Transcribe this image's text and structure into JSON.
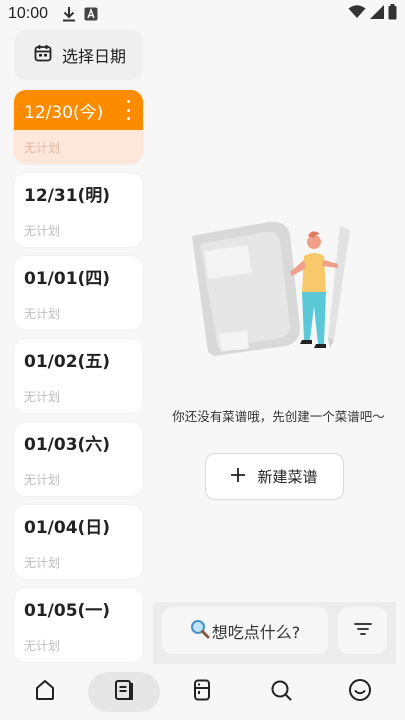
{
  "status_bar": {
    "time": "10:00",
    "icons": [
      "download-icon",
      "a-notification-icon",
      "wifi-icon",
      "signal-icon",
      "battery-icon"
    ]
  },
  "date_select": {
    "label": "选择日期",
    "icon": "calendar-icon"
  },
  "dates": [
    {
      "date": "12/30(今)",
      "plan": "无计划",
      "active": true
    },
    {
      "date": "12/31(明)",
      "plan": "无计划",
      "active": false
    },
    {
      "date": "01/01(四)",
      "plan": "无计划",
      "active": false
    },
    {
      "date": "01/02(五)",
      "plan": "无计划",
      "active": false
    },
    {
      "date": "01/03(六)",
      "plan": "无计划",
      "active": false
    },
    {
      "date": "01/04(日)",
      "plan": "无计划",
      "active": false
    },
    {
      "date": "01/05(一)",
      "plan": "无计划",
      "active": false
    }
  ],
  "empty_state": {
    "message": "你还没有菜谱哦，先创建一个菜谱吧～",
    "new_button": "新建菜谱"
  },
  "search": {
    "label": "想吃点什么?"
  },
  "nav": [
    "home-icon",
    "recipe-book-icon",
    "fridge-icon",
    "search-icon",
    "smile-icon"
  ],
  "colors": {
    "accent": "#fb8c00",
    "accent_light": "#fde7db",
    "illustration_person_shirt": "#f7c96b",
    "illustration_person_pants": "#5bc8d8"
  }
}
